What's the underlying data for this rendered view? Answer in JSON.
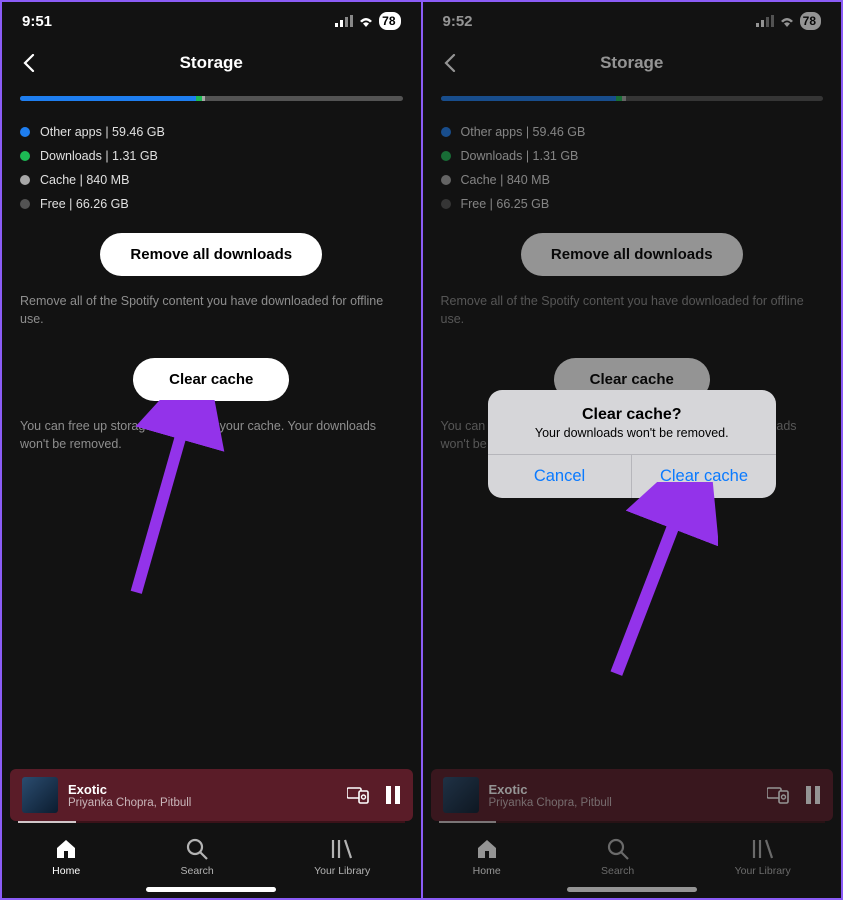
{
  "left": {
    "status": {
      "time": "9:51",
      "battery": "78"
    },
    "title": "Storage",
    "bar": {
      "blue_pct": 46,
      "green_pct": 1.5,
      "grey_pct": 1
    },
    "legend": [
      {
        "label": "Other apps | 59.46 GB",
        "dot": "blue"
      },
      {
        "label": "Downloads | 1.31 GB",
        "dot": "green"
      },
      {
        "label": "Cache | 840 MB",
        "dot": "lgrey"
      },
      {
        "label": "Free | 66.26 GB",
        "dot": "dgrey"
      }
    ],
    "remove_btn": "Remove all downloads",
    "remove_help": "Remove all of the Spotify content you have downloaded for offline use.",
    "clear_btn": "Clear cache",
    "clear_help": "You can free up storage by clearing your cache. Your downloads won't be removed.",
    "now_playing": {
      "title": "Exotic",
      "artist": "Priyanka Chopra, Pitbull"
    },
    "tabs": {
      "home": "Home",
      "search": "Search",
      "library": "Your Library"
    }
  },
  "right": {
    "status": {
      "time": "9:52",
      "battery": "78"
    },
    "title": "Storage",
    "bar": {
      "blue_pct": 46,
      "green_pct": 1.5,
      "grey_pct": 1
    },
    "legend": [
      {
        "label": "Other apps | 59.46 GB",
        "dot": "blue"
      },
      {
        "label": "Downloads | 1.31 GB",
        "dot": "green"
      },
      {
        "label": "Cache | 840 MB",
        "dot": "lgrey"
      },
      {
        "label": "Free | 66.25 GB",
        "dot": "dgrey"
      }
    ],
    "remove_btn": "Remove all downloads",
    "remove_help": "Remove all of the Spotify content you have downloaded for offline use.",
    "clear_btn": "Clear cache",
    "clear_help": "You can free up storage by clearing your cache. Your downloads won't be removed.",
    "now_playing": {
      "title": "Exotic",
      "artist": "Priyanka Chopra, Pitbull"
    },
    "tabs": {
      "home": "Home",
      "search": "Search",
      "library": "Your Library"
    },
    "dialog": {
      "title": "Clear cache?",
      "message": "Your downloads won't be removed.",
      "cancel": "Cancel",
      "confirm": "Clear cache"
    }
  },
  "arrow_color": "#9333ea"
}
